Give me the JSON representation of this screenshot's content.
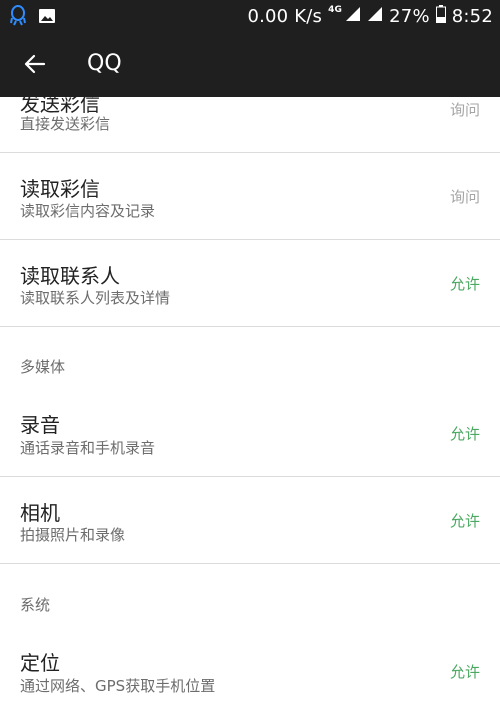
{
  "status_bar": {
    "speed": "0.00 K/s",
    "network_type": "4G",
    "battery": "27%",
    "time": "8:52",
    "icons": [
      "qq-icon",
      "image-icon",
      "signal-icon",
      "wifi-signal-icon",
      "battery-icon"
    ]
  },
  "app_bar": {
    "title": "QQ",
    "back_icon": "arrow-left-icon"
  },
  "colors": {
    "bar_background": "#1f1f1f",
    "allow": "#4aa860",
    "ask": "#a5a5a5",
    "divider": "#dcdcdc"
  },
  "permissions": [
    {
      "title": "发送彩信",
      "desc": "直接发送彩信",
      "status": "询问"
    },
    {
      "title": "读取彩信",
      "desc": "读取彩信内容及记录",
      "status": "询问"
    },
    {
      "title": "读取联系人",
      "desc": "读取联系人列表及详情",
      "status": "允许"
    }
  ],
  "sections": [
    {
      "header": "多媒体",
      "items": [
        {
          "title": "录音",
          "desc": "通话录音和手机录音",
          "status": "允许"
        },
        {
          "title": "相机",
          "desc": "拍摄照片和录像",
          "status": "允许"
        }
      ]
    },
    {
      "header": "系统",
      "items": [
        {
          "title": "定位",
          "desc": "通过网络、GPS获取手机位置",
          "status": "允许"
        }
      ]
    }
  ]
}
